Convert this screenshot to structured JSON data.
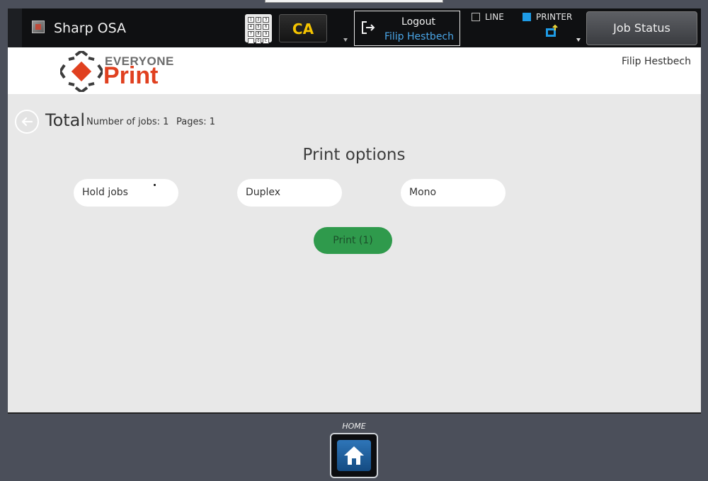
{
  "topbar": {
    "app_title": "Sharp OSA",
    "keypad_keys": [
      "1",
      "2",
      "3",
      "4",
      "5",
      "6",
      "7",
      "8",
      "9",
      "",
      "0",
      "C"
    ],
    "ca_label": "CA",
    "logout_label": "Logout",
    "logout_user": "Filip Hestbech",
    "line_label": "LINE",
    "printer_label": "PRINTER",
    "job_status_label": "Job Status"
  },
  "header": {
    "logo_top": "EVERYONE",
    "logo_bottom": "Print",
    "user_name": "Filip Hestbech"
  },
  "main": {
    "total_label": "Total",
    "jobs_text": "Number of jobs: 1",
    "pages_text": "Pages: 1",
    "options_title": "Print options",
    "options": [
      {
        "label": "Hold jobs"
      },
      {
        "label": "Duplex"
      },
      {
        "label": "Mono"
      }
    ],
    "print_button": "Print (1)"
  },
  "footer": {
    "home_label": "HOME"
  },
  "colors": {
    "accent_blue": "#1e9be6",
    "logo_orange": "#e0401f",
    "print_green": "#2f9a4c",
    "ca_yellow": "#f5c400"
  }
}
